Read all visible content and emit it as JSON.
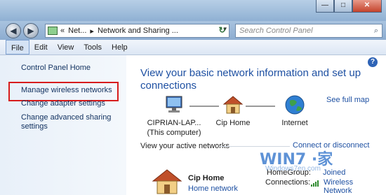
{
  "window": {
    "controls": {
      "minimize": "—",
      "maximize": "□",
      "close": "✕"
    }
  },
  "addressbar": {
    "back_icon": "◀",
    "forward_icon": "▶",
    "crumbs": [
      "«",
      "Net...",
      "▸",
      "Network and Sharing ..."
    ],
    "dropdown_icon": "▾",
    "refresh_icon": "↻",
    "search_placeholder": "Search Control Panel",
    "search_icon": "⌕"
  },
  "menu": [
    "File",
    "Edit",
    "View",
    "Tools",
    "Help"
  ],
  "left_pane": {
    "home": "Control Panel Home",
    "tasks": [
      "Manage wireless networks",
      "Change adapter settings",
      "Change advanced sharing settings"
    ],
    "highlight_color": "#d71c1c"
  },
  "main": {
    "help_icon": "?",
    "heading": "View your basic network information and set up connections",
    "see_full_map": "See full map",
    "map": {
      "computer": {
        "name": "CIPRIAN-LAP...",
        "sub": "(This computer)"
      },
      "home": {
        "name": "Cip Home"
      },
      "internet": {
        "name": "Internet"
      }
    },
    "active_networks_label": "View your active networks",
    "connect_link": "Connect or disconnect",
    "network": {
      "name": "Cip Home",
      "type": "Home network",
      "homegroup_label": "HomeGroup:",
      "homegroup_value": "Joined",
      "connections_label": "Connections:",
      "connections_value": "Wireless Network"
    }
  },
  "colors": {
    "link": "#1e50a2",
    "accent": "#2e63b6"
  },
  "watermark": {
    "brand": "WIN7 ·家",
    "sub": "Windows7en.com"
  }
}
